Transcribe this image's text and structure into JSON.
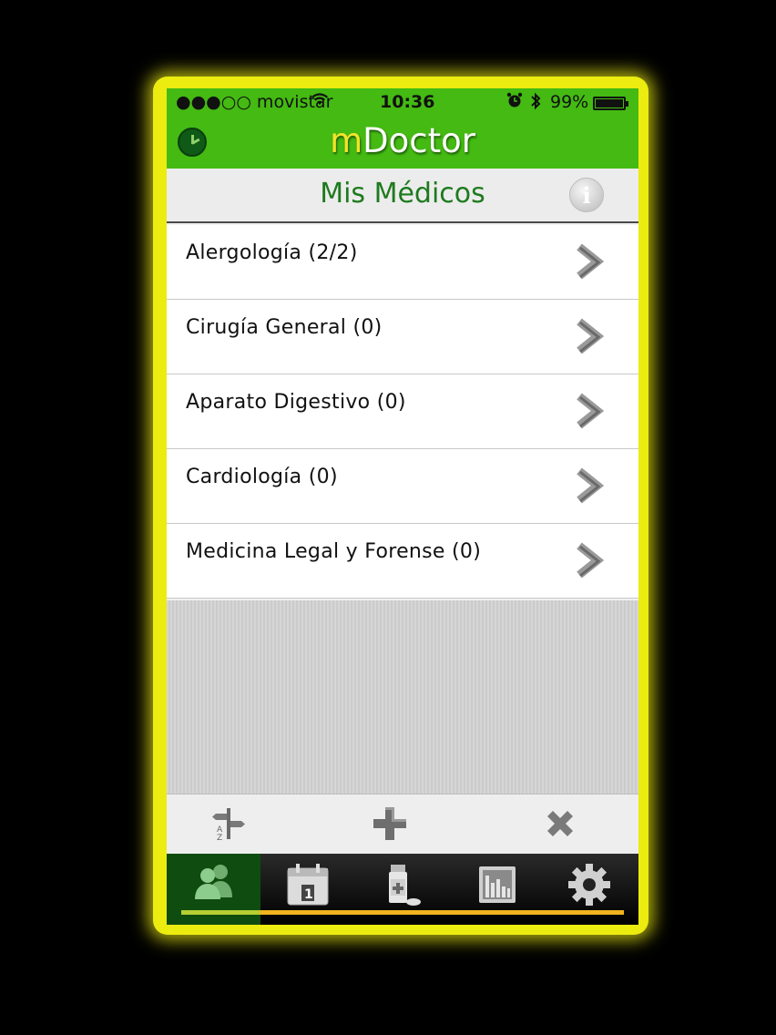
{
  "status_bar": {
    "carrier": "●●●○○ movistar",
    "time": "10:36",
    "battery": "99%",
    "battery_level": 0.99
  },
  "header": {
    "title_m": "m",
    "title_rest": "Doctor"
  },
  "section": {
    "title": "Mis Médicos",
    "info_label": "i"
  },
  "list": {
    "items": [
      {
        "label": "Alergología (2/2)"
      },
      {
        "label": "Cirugía General (0)"
      },
      {
        "label": "Aparato Digestivo (0)"
      },
      {
        "label": "Cardiología (0)"
      },
      {
        "label": "Medicina Legal y Forense (0)"
      }
    ]
  },
  "toolbar": {
    "icons": [
      "sort-az-icon",
      "add-icon",
      "delete-icon"
    ]
  },
  "tabbar": {
    "tabs": [
      "doctors-icon",
      "calendar-icon",
      "medication-icon",
      "statistics-icon",
      "settings-icon"
    ],
    "active": 0,
    "calendar_day": "1"
  },
  "colors": {
    "header_green": "#44ba12",
    "frame_yellow": "#ecec10",
    "title_green": "#1e7a1e",
    "accent_orange": "#f0b41e"
  }
}
